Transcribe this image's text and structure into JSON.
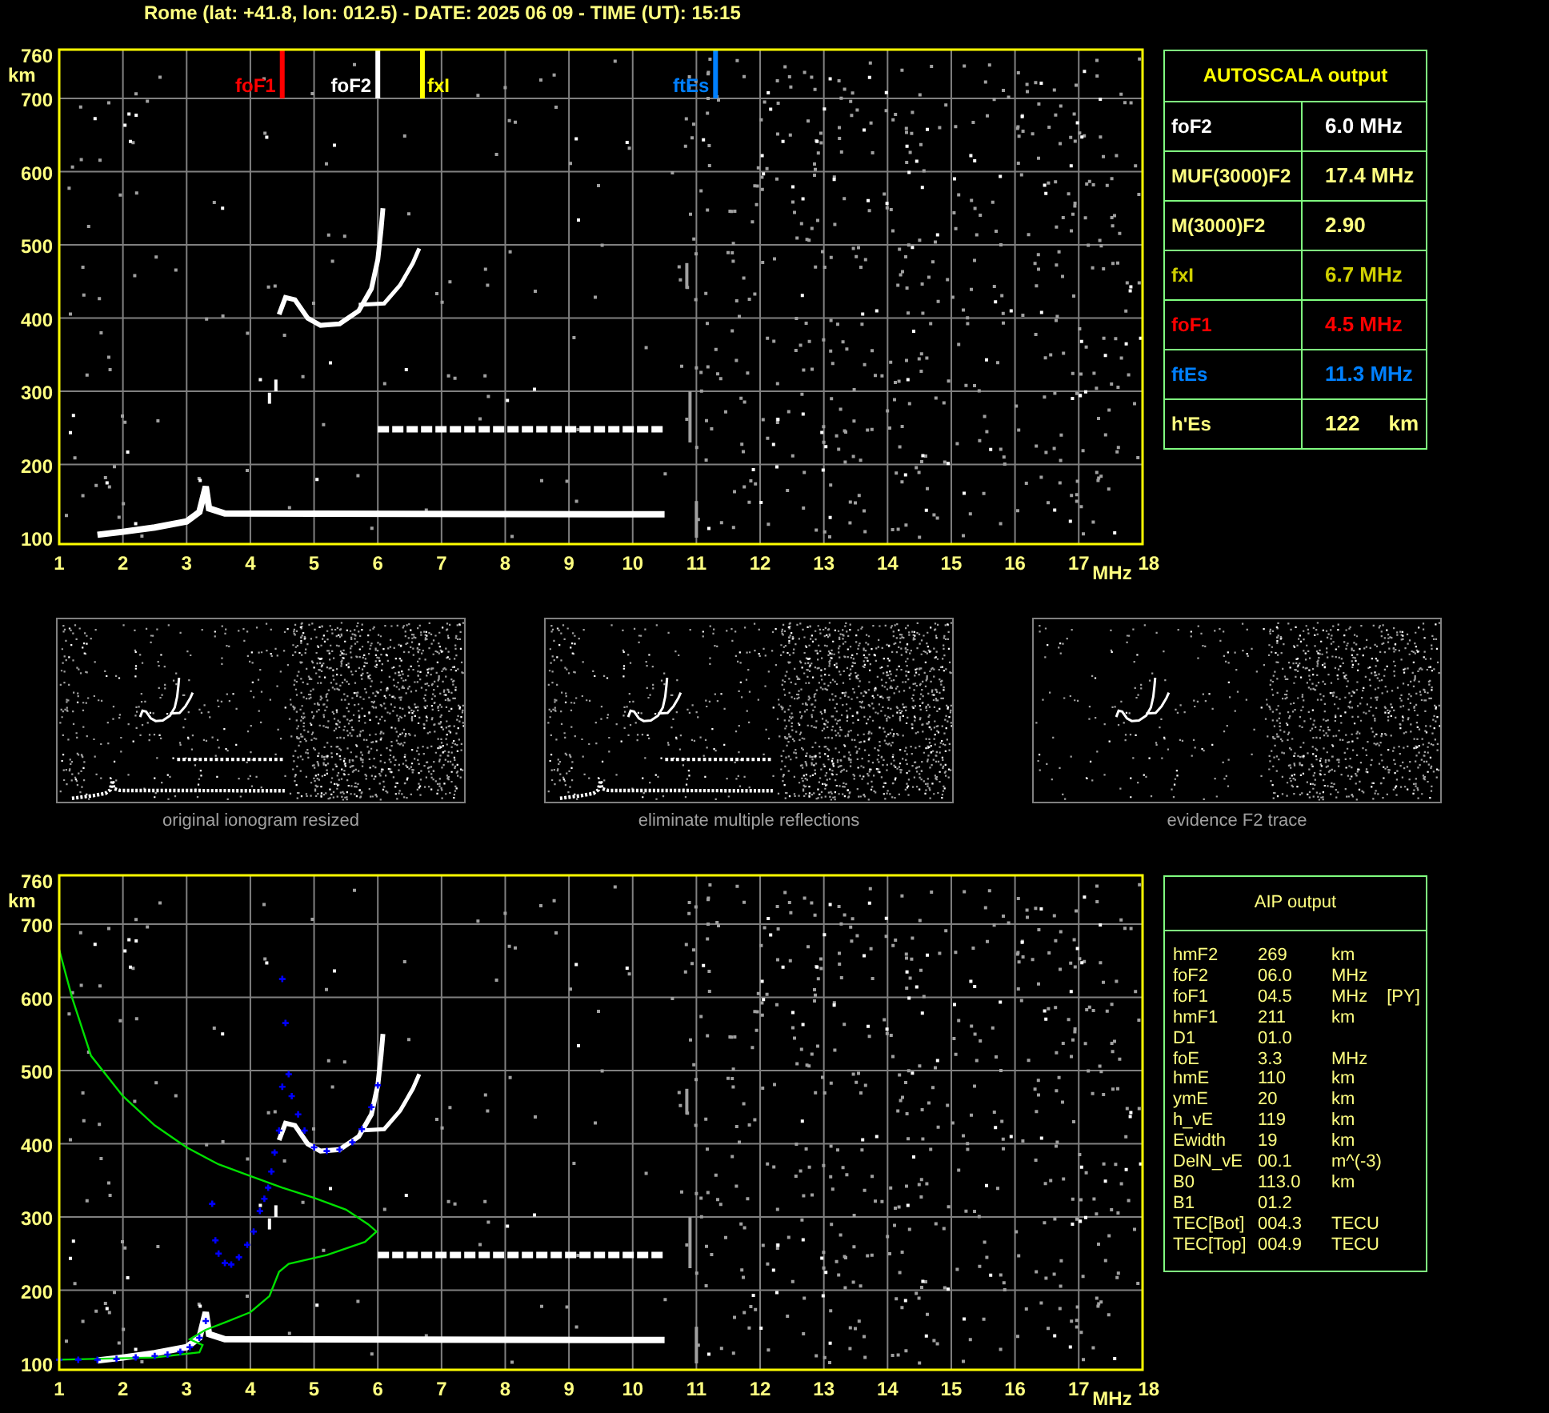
{
  "header": "Rome (lat: +41.8, lon: 012.5) - DATE: 2025 06 09 - TIME (UT): 15:15",
  "top_ionogram": {
    "y_unit": "km",
    "x_unit": "MHz",
    "y_ticks": [
      "760",
      "700",
      "600",
      "500",
      "400",
      "300",
      "200",
      "100"
    ],
    "x_ticks": [
      "1",
      "2",
      "3",
      "4",
      "5",
      "6",
      "7",
      "8",
      "9",
      "10",
      "11",
      "12",
      "13",
      "14",
      "15",
      "16",
      "17",
      "18"
    ],
    "markers": [
      {
        "label": "foF1",
        "color": "#ff0000"
      },
      {
        "label": "foF2",
        "color": "#ffffff"
      },
      {
        "label": "fxI",
        "color": "#ffff00"
      },
      {
        "label": "ftEs",
        "color": "#0080ff"
      }
    ]
  },
  "autoscala": {
    "title": "AUTOSCALA output",
    "rows": [
      {
        "name": "foF2",
        "value": "6.0 MHz",
        "color": "#ffffff"
      },
      {
        "name": "MUF(3000)F2",
        "value": "17.4 MHz",
        "color": "#ffff80"
      },
      {
        "name": "M(3000)F2",
        "value": "2.90",
        "color": "#ffff80"
      },
      {
        "name": "fxI",
        "value": "6.7 MHz",
        "color": "#d0d000"
      },
      {
        "name": "foF1",
        "value": "4.5 MHz",
        "color": "#ff0000"
      },
      {
        "name": "ftEs",
        "value": "11.3 MHz",
        "color": "#0080ff"
      },
      {
        "name": "h'Es",
        "value": "122     km",
        "color": "#ffff80"
      }
    ]
  },
  "thumbnails": [
    {
      "caption": "original ionogram resized"
    },
    {
      "caption": "eliminate multiple reflections"
    },
    {
      "caption": "evidence F2 trace"
    }
  ],
  "bottom_ionogram": {
    "y_unit": "km",
    "x_unit": "MHz",
    "y_ticks": [
      "760",
      "700",
      "600",
      "500",
      "400",
      "300",
      "200",
      "100"
    ],
    "x_ticks": [
      "1",
      "2",
      "3",
      "4",
      "5",
      "6",
      "7",
      "8",
      "9",
      "10",
      "11",
      "12",
      "13",
      "14",
      "15",
      "16",
      "17",
      "18"
    ]
  },
  "aip": {
    "title": "AIP output",
    "rows": [
      {
        "name": "hmF2",
        "value": "269",
        "unit": "km"
      },
      {
        "name": "foF2",
        "value": "06.0",
        "unit": "MHz"
      },
      {
        "name": "foF1",
        "value": "04.5",
        "unit": "MHz",
        "note": "[PY]"
      },
      {
        "name": "hmF1",
        "value": "211",
        "unit": "km"
      },
      {
        "name": "D1",
        "value": "01.0"
      },
      {
        "name": "foE",
        "value": "3.3",
        "unit": "MHz"
      },
      {
        "name": "hmE",
        "value": "110",
        "unit": "km"
      },
      {
        "name": "ymE",
        "value": "20",
        "unit": "km"
      },
      {
        "name": "h_vE",
        "value": "119",
        "unit": "km"
      },
      {
        "name": "Ewidth",
        "value": "19",
        "unit": "km"
      },
      {
        "name": "DelN_vE",
        "value": "00.1",
        "unit": "m^(-3)"
      },
      {
        "name": "B0",
        "value": "113.0",
        "unit": "km"
      },
      {
        "name": "B1",
        "value": "01.2"
      },
      {
        "name": "TEC[Bot]",
        "value": "004.3",
        "unit": "TECU"
      },
      {
        "name": "TEC[Top]",
        "value": "004.9",
        "unit": "TECU"
      }
    ]
  }
}
